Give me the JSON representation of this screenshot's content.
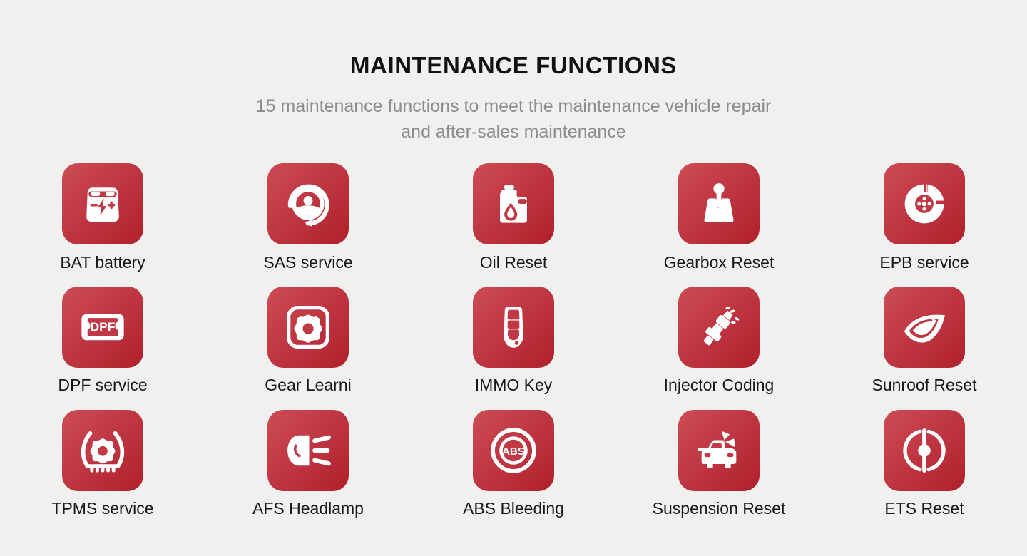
{
  "header": {
    "title": "MAINTENANCE FUNCTIONS",
    "subtitle_line1": "15 maintenance functions to meet the maintenance vehicle repair",
    "subtitle_line2": "and after-sales maintenance",
    "function_count": 15
  },
  "theme": {
    "background": "#f0f0ef",
    "tile_gradient_start": "#cd4c56",
    "tile_gradient_end": "#b0202b",
    "title_color": "#111111",
    "subtitle_color": "#8d8d8d",
    "label_color": "#181818",
    "icon_color": "#ffffff"
  },
  "functions": [
    {
      "label": "BAT battery",
      "icon": "battery-icon"
    },
    {
      "label": "SAS service",
      "icon": "steering-wheel-reset-icon"
    },
    {
      "label": "Oil Reset",
      "icon": "oil-can-icon"
    },
    {
      "label": "Gearbox Reset",
      "icon": "gear-shifter-icon"
    },
    {
      "label": "EPB service",
      "icon": "brake-disc-icon"
    },
    {
      "label": "DPF service",
      "icon": "dpf-filter-icon"
    },
    {
      "label": "Gear Learni",
      "icon": "cog-in-square-icon"
    },
    {
      "label": "IMMO Key",
      "icon": "key-fob-icon"
    },
    {
      "label": "Injector Coding",
      "icon": "fuel-injector-icon"
    },
    {
      "label": "Sunroof Reset",
      "icon": "sunroof-panel-icon"
    },
    {
      "label": "TPMS service",
      "icon": "tire-pressure-icon"
    },
    {
      "label": "AFS Headlamp",
      "icon": "headlamp-icon"
    },
    {
      "label": "ABS Bleeding",
      "icon": "abs-warning-icon"
    },
    {
      "label": "Suspension Reset",
      "icon": "car-suspension-icon"
    },
    {
      "label": "ETS Reset",
      "icon": "throttle-body-icon"
    }
  ],
  "icon_text": {
    "dpf": "DPF",
    "abs": "ABS"
  }
}
